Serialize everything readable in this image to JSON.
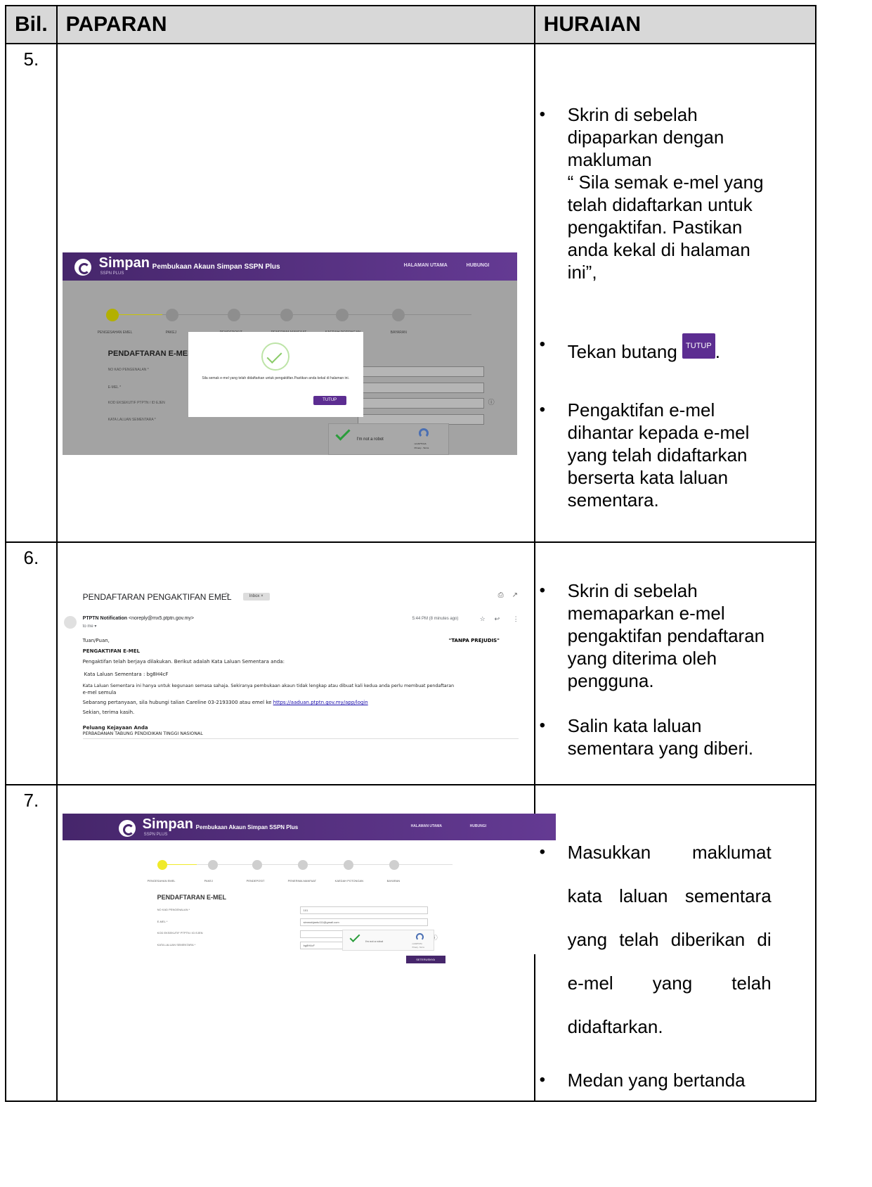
{
  "table": {
    "headers": {
      "bil": "Bil.",
      "paparan": "PAPARAN",
      "huraian": "HURAIAN"
    },
    "rows": [
      {
        "num": "5.",
        "bullets": [
          "Skrin di sebelah dipaparkan dengan makluman\n “ Sila semak e-mel yang telah didaftarkan untuk pengaktifan. Pastikan anda kekal di halaman ini”,",
          "Pengaktifan e-mel dihantar kepada e-mel yang telah didaftarkan berserta kata laluan sementara."
        ],
        "press": {
          "prefix": "Tekan butang ",
          "button": "TUTUP",
          "suffix": "."
        }
      },
      {
        "num": "6.",
        "bullets": [
          "Skrin di sebelah memaparkan e-mel pengaktifan pendaftaran yang diterima oleh pengguna.",
          "Salin kata laluan sementara yang diberi."
        ]
      },
      {
        "num": "7.",
        "bullets": [
          "Masukkan maklumat kata laluan sementara yang telah diberikan di e-mel yang telah didaftarkan.",
          "Medan yang bertanda"
        ]
      }
    ]
  },
  "portal": {
    "brand": "Simpan",
    "brand_sub": "SSPN PLUS",
    "title": "Pembukaan Akaun Simpan SSPN Plus",
    "nav": [
      "HALAMAN UTAMA",
      "HUBUNGI"
    ],
    "nav7": [
      "HALAMAN UTAMA",
      "HUBUNGI"
    ],
    "steps": [
      "PENGESAHAN EMEL",
      "PAKEJ",
      "PENDEPOSIT",
      "PENERIMA MANFAAT",
      "KAEDAH POTONGAN",
      "BAYARAN"
    ],
    "form_title": "PENDAFTARAN E-MEL",
    "fields": [
      "NO KAD PENGENALAN *",
      "E-MEL *",
      "KOD EKSEKUTIF PTPTN / ID EJEN",
      "KATA LALUAN SEMENTARA *"
    ],
    "field_values": [
      "101",
      "simmahjantu111@gmail.com",
      "",
      "bg8H4cF"
    ],
    "captcha": "I'm not a robot",
    "captcha_brand": "reCAPTCHA",
    "captcha_links": "Privacy - Terms",
    "info_icon": "ⓘ",
    "submit": "SETERUSNYA"
  },
  "modal": {
    "message": "Sila semak e-mel yang telah didaftarkan untuk pengaktifan.Pastikan anda kekal di halaman ini.",
    "button": "TUTUP"
  },
  "email": {
    "subject": "PENDAFTARAN PENGAKTIFAN EMEL",
    "label_tag": "Inbox ×",
    "forward_glyph": "ᐳ",
    "from_name": "PTPTN Notification",
    "from_addr": "<noreply@mx5.ptptn.gov.my>",
    "to": "to me ▾",
    "time": "5:44 PM (8 minutes ago)",
    "greeting": "Tuan/Puan,",
    "tagline": "\"TANPA PREJUDIS\"",
    "heading": "PENGAKTIFAN E-MEL",
    "line1": "Pengaktifan telah berjaya dilakukan. Berikut adalah Kata Laluan Sementara anda:",
    "password_line": "Kata Laluan Sementara : bg8H4cF",
    "line2": "Kata Laluan Sementara ini hanya untuk kegunaan semasa sahaja. Sekiranya pembukaan akaun tidak lengkap atau dibuat kali kedua anda perlu membuat pendaftaran",
    "line2b": "e-mel semula",
    "line3": "Sebarang pertanyaan, sila hubungi talian Careline 03-2193300 atau emel ke ",
    "link": "https://aaduan.ptptn.gov.my/app/login",
    "thanks": "Sekian, terima kasih.",
    "sig1": "Peluang Kejayaan Anda",
    "sig2": "PERBADANAN TABUNG PENDIDIKAN TINGGI NASIONAL"
  }
}
